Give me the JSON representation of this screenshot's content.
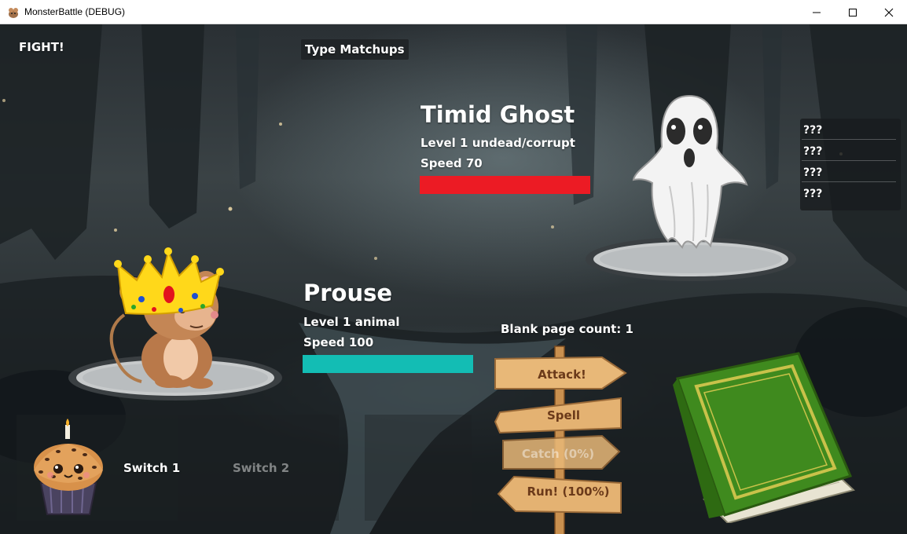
{
  "window": {
    "title": "MonsterBattle (DEBUG)",
    "icon": "monster-app-icon",
    "controls": [
      "minimize-icon",
      "maximize-icon",
      "close-icon"
    ]
  },
  "battle": {
    "fight_label": "FIGHT!",
    "type_matchups_label": "Type Matchups",
    "enemy": {
      "name": "Timid Ghost",
      "level_text": "Level 1 undead/corrupt",
      "speed_text": "Speed 70",
      "hp_fraction": 1.0,
      "hp_color": "#ec1b24",
      "moves": [
        "???",
        "???",
        "???",
        "???"
      ]
    },
    "player": {
      "name": "Prouse",
      "level_text": "Level 1 animal",
      "speed_text": "Speed 100",
      "hp_fraction": 1.0,
      "hp_color": "#13bdb4"
    },
    "blank_page_count": "Blank page count: 1",
    "actions": {
      "attack": "Attack!",
      "spell": "Spell",
      "catch": "Catch (0%)",
      "run": "Run! (100%)"
    },
    "switches": {
      "switch1": "Switch 1",
      "switch2": "Switch 2"
    }
  }
}
